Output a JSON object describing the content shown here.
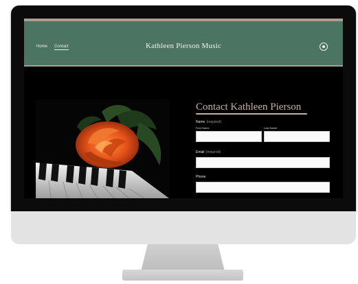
{
  "header": {
    "nav": [
      {
        "label": "Home"
      },
      {
        "label": "Contact"
      }
    ],
    "site_title": "Kathleen Pierson Music"
  },
  "form": {
    "title": "Contact Kathleen Pierson",
    "name_label": "Name",
    "required_tag": "(required)",
    "first_name_label": "First Name",
    "last_name_label": "Last Name",
    "email_label": "Email",
    "phone_label": "Phone"
  },
  "colors": {
    "header_bg": "#4b7462",
    "accent_title": "#c7b2a2",
    "screen_bg": "#000000"
  },
  "icons": {
    "header_right": "social-circle-icon"
  }
}
